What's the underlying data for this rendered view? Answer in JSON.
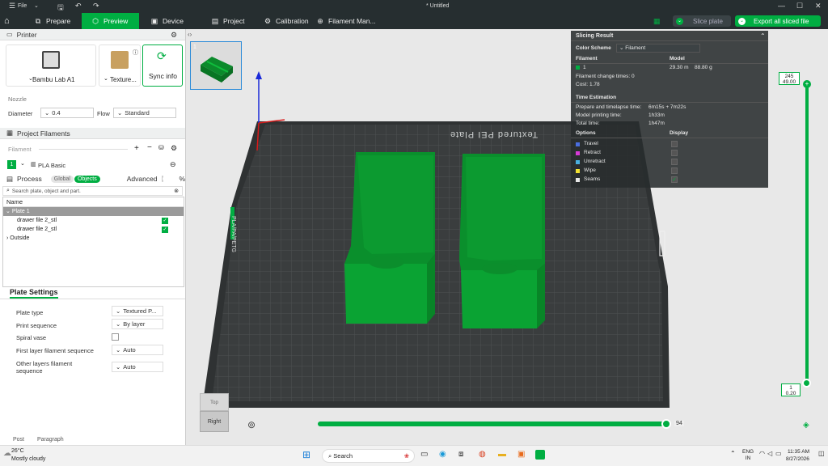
{
  "titlebar": {
    "file_menu": "File",
    "doc_title": "* Untitled"
  },
  "toolbar": {
    "tabs": [
      "Prepare",
      "Preview",
      "Device",
      "Project",
      "Calibration",
      "Filament Man..."
    ],
    "slice_plate": "Slice plate",
    "export_all": "Export all sliced file"
  },
  "printer": {
    "section_title": "Printer",
    "printer_name": "Bambu Lab A1",
    "plate_name": "Texture...",
    "sync_label": "Sync info",
    "nozzle_label": "Nozzle",
    "diameter_label": "Diameter",
    "diameter_value": "0.4",
    "flow_label": "Flow",
    "flow_value": "Standard"
  },
  "filaments": {
    "section_title": "Project Filaments",
    "header": "Filament",
    "item_index": "1",
    "item_name": "PLA Basic"
  },
  "process": {
    "section_title": "Process",
    "global": "Global",
    "objects": "Objects",
    "advanced": "Advanced",
    "search_placeholder": "Search plate, object and part.",
    "col_name": "Name",
    "plate": "Plate 1",
    "objects_list": [
      "drawer file 2_stl",
      "drawer file 2_stl"
    ],
    "outside": "Outside"
  },
  "plate_settings": {
    "title": "Plate Settings",
    "rows": [
      {
        "label": "Plate type",
        "value": "Textured P..."
      },
      {
        "label": "Print sequence",
        "value": "By layer"
      },
      {
        "label": "Spiral vase",
        "value": ""
      },
      {
        "label": "First layer filament sequence",
        "value": "Auto"
      },
      {
        "label": "Other layers filament sequence",
        "value": "Auto"
      }
    ]
  },
  "thumbnail": {
    "plate_number": "1"
  },
  "bed": {
    "label": "Textured PEI Plate",
    "side_text": "PLA/PA/PETG"
  },
  "slicing": {
    "title": "Slicing Result",
    "color_scheme_label": "Color Scheme",
    "color_scheme_value": "Filament",
    "col_filament": "Filament",
    "col_model": "Model",
    "filament_index": "1",
    "model_length": "29.30 m",
    "model_weight": "88.80 g",
    "change_times": "Filament change times:  0",
    "cost": "Cost:  1.78",
    "time_title": "Time Estimation",
    "prepare_label": "Prepare and timelapse time:",
    "prepare_value": "6m15s + 7m22s",
    "model_time_label": "Model printing time:",
    "model_time_value": "1h33m",
    "total_label": "Total time:",
    "total_value": "1h47m",
    "options_label": "Options",
    "display_label": "Display",
    "options": [
      {
        "name": "Travel",
        "color": "#4a6ee0",
        "checked": false
      },
      {
        "name": "Retract",
        "color": "#d83ad8",
        "checked": false
      },
      {
        "name": "Unretract",
        "color": "#4ab0e0",
        "checked": false
      },
      {
        "name": "Wipe",
        "color": "#f2e232",
        "checked": false
      },
      {
        "name": "Seams",
        "color": "#e8e8e8",
        "checked": true
      }
    ]
  },
  "layer_slider": {
    "top_layer": "245",
    "top_height": "49.00",
    "bottom_layer": "1",
    "bottom_height": "0.20"
  },
  "move_slider": {
    "value": "94"
  },
  "view_cube": {
    "face_top": "Top",
    "face_front": "Right"
  },
  "bottom_text": {
    "post": "Post",
    "paragraph": "Paragraph"
  },
  "taskbar": {
    "weather_temp": "26°C",
    "weather_desc": "Mostly cloudy",
    "search": "Search",
    "lang": "ENG",
    "lang_region": "IN",
    "time": "11:35 AM",
    "date": "8/27/2026"
  },
  "colors": {
    "accent": "#00ae42",
    "dark": "#262e30",
    "model_green": "#0d9a2f"
  }
}
